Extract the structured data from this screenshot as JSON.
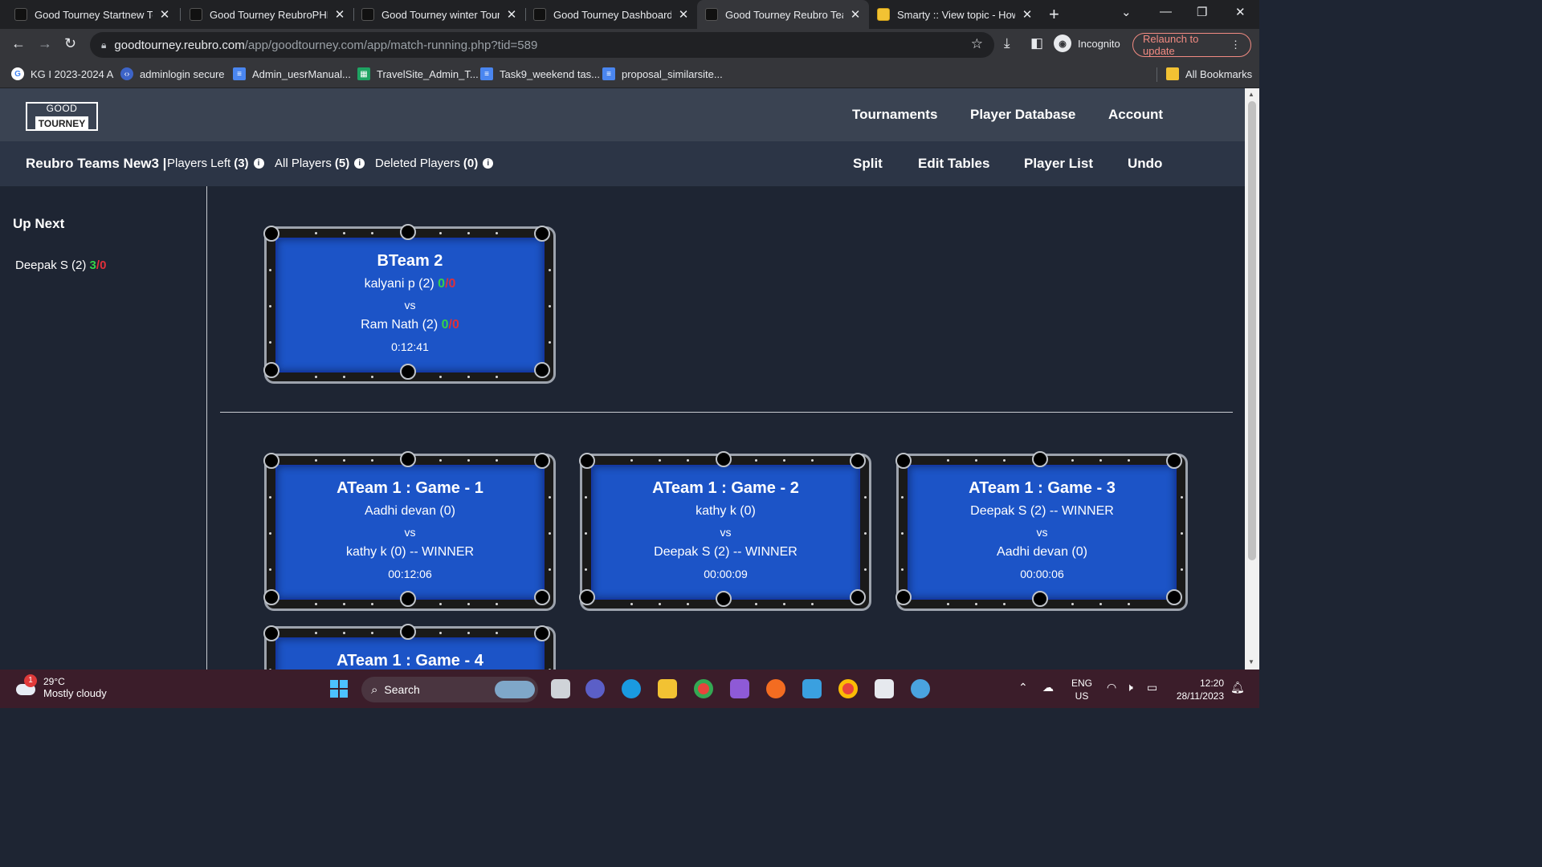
{
  "browser": {
    "tabs": [
      {
        "title": "Good Tourney Startnew To",
        "favicon": "good-tourney",
        "active": false
      },
      {
        "title": "Good Tourney ReubroPHP",
        "favicon": "good-tourney",
        "active": false
      },
      {
        "title": "Good Tourney winter Tourn",
        "favicon": "good-tourney",
        "active": false
      },
      {
        "title": "Good Tourney Dashboard",
        "favicon": "good-tourney",
        "active": false
      },
      {
        "title": "Good Tourney Reubro Tean",
        "favicon": "good-tourney",
        "active": true
      },
      {
        "title": "Smarty :: View topic - How",
        "favicon": "smarty",
        "active": false
      }
    ],
    "url_host": "goodtourney.reubro.com",
    "url_path": "/app/goodtourney.com/app/match-running.php?tid=589",
    "incognito_label": "Incognito",
    "relaunch_label": "Relaunch to update",
    "bookmarks": [
      {
        "label": "KG I 2023-2024 A",
        "icon": "google-icon"
      },
      {
        "label": "adminlogin secure",
        "icon": "code-icon"
      },
      {
        "label": "Admin_uesrManual...",
        "icon": "docs-icon"
      },
      {
        "label": "TravelSite_Admin_T...",
        "icon": "sheets-icon"
      },
      {
        "label": "Task9_weekend tas...",
        "icon": "docs-icon"
      },
      {
        "label": "proposal_similarsite...",
        "icon": "docs-icon"
      }
    ],
    "all_bookmarks": "All Bookmarks"
  },
  "header": {
    "logo_top": "GOOD",
    "logo_bottom": "TOURNEY",
    "nav": [
      "Tournaments",
      "Player Database",
      "Account"
    ]
  },
  "subbar": {
    "tournament_name": "Reubro Teams New3 |",
    "players_left_label": "Players Left",
    "players_left_count": "(3)",
    "all_players_label": "All Players",
    "all_players_count": "(5)",
    "deleted_players_label": "Deleted Players",
    "deleted_players_count": "(0)",
    "actions": [
      "Split",
      "Edit Tables",
      "Player List",
      "Undo"
    ]
  },
  "sidebar": {
    "title": "Up Next",
    "items": [
      {
        "name": "Deepak S (2)",
        "wins": "3",
        "sep": "/",
        "losses": "0"
      }
    ]
  },
  "running_tables": [
    {
      "title": "BTeam 2",
      "player1": "kalyani p (2)",
      "p1_wins": "0",
      "p1_losses": "0",
      "vs": "vs",
      "player2": "Ram Nath (2)",
      "p2_wins": "0",
      "p2_losses": "0",
      "time": "0:12:41"
    }
  ],
  "completed_tables": [
    {
      "title": "ATeam 1 : Game - 1",
      "player1": "Aadhi devan (0)",
      "vs": "vs",
      "player2": "kathy k (0) -- WINNER",
      "time": "00:12:06"
    },
    {
      "title": "ATeam 1 : Game - 2",
      "player1": "kathy k (0)",
      "vs": "vs",
      "player2": "Deepak S (2) -- WINNER",
      "time": "00:00:09"
    },
    {
      "title": "ATeam 1 : Game - 3",
      "player1": "Deepak S (2) -- WINNER",
      "vs": "vs",
      "player2": "Aadhi devan (0)",
      "time": "00:00:06"
    },
    {
      "title": "ATeam 1 : Game - 4"
    }
  ],
  "taskbar": {
    "weather_badge": "1",
    "temperature": "29°C",
    "condition": "Mostly cloudy",
    "search_placeholder": "Search",
    "lang_top": "ENG",
    "lang_bottom": "US",
    "time": "12:20",
    "date": "28/11/2023"
  },
  "colors": {
    "header_bg": "#3a4352",
    "subbar_bg": "#2c3546",
    "page_bg": "#1e2533",
    "cloth": "#1c54c7",
    "wins_green": "#36d14a",
    "losses_red": "#e0303a"
  }
}
